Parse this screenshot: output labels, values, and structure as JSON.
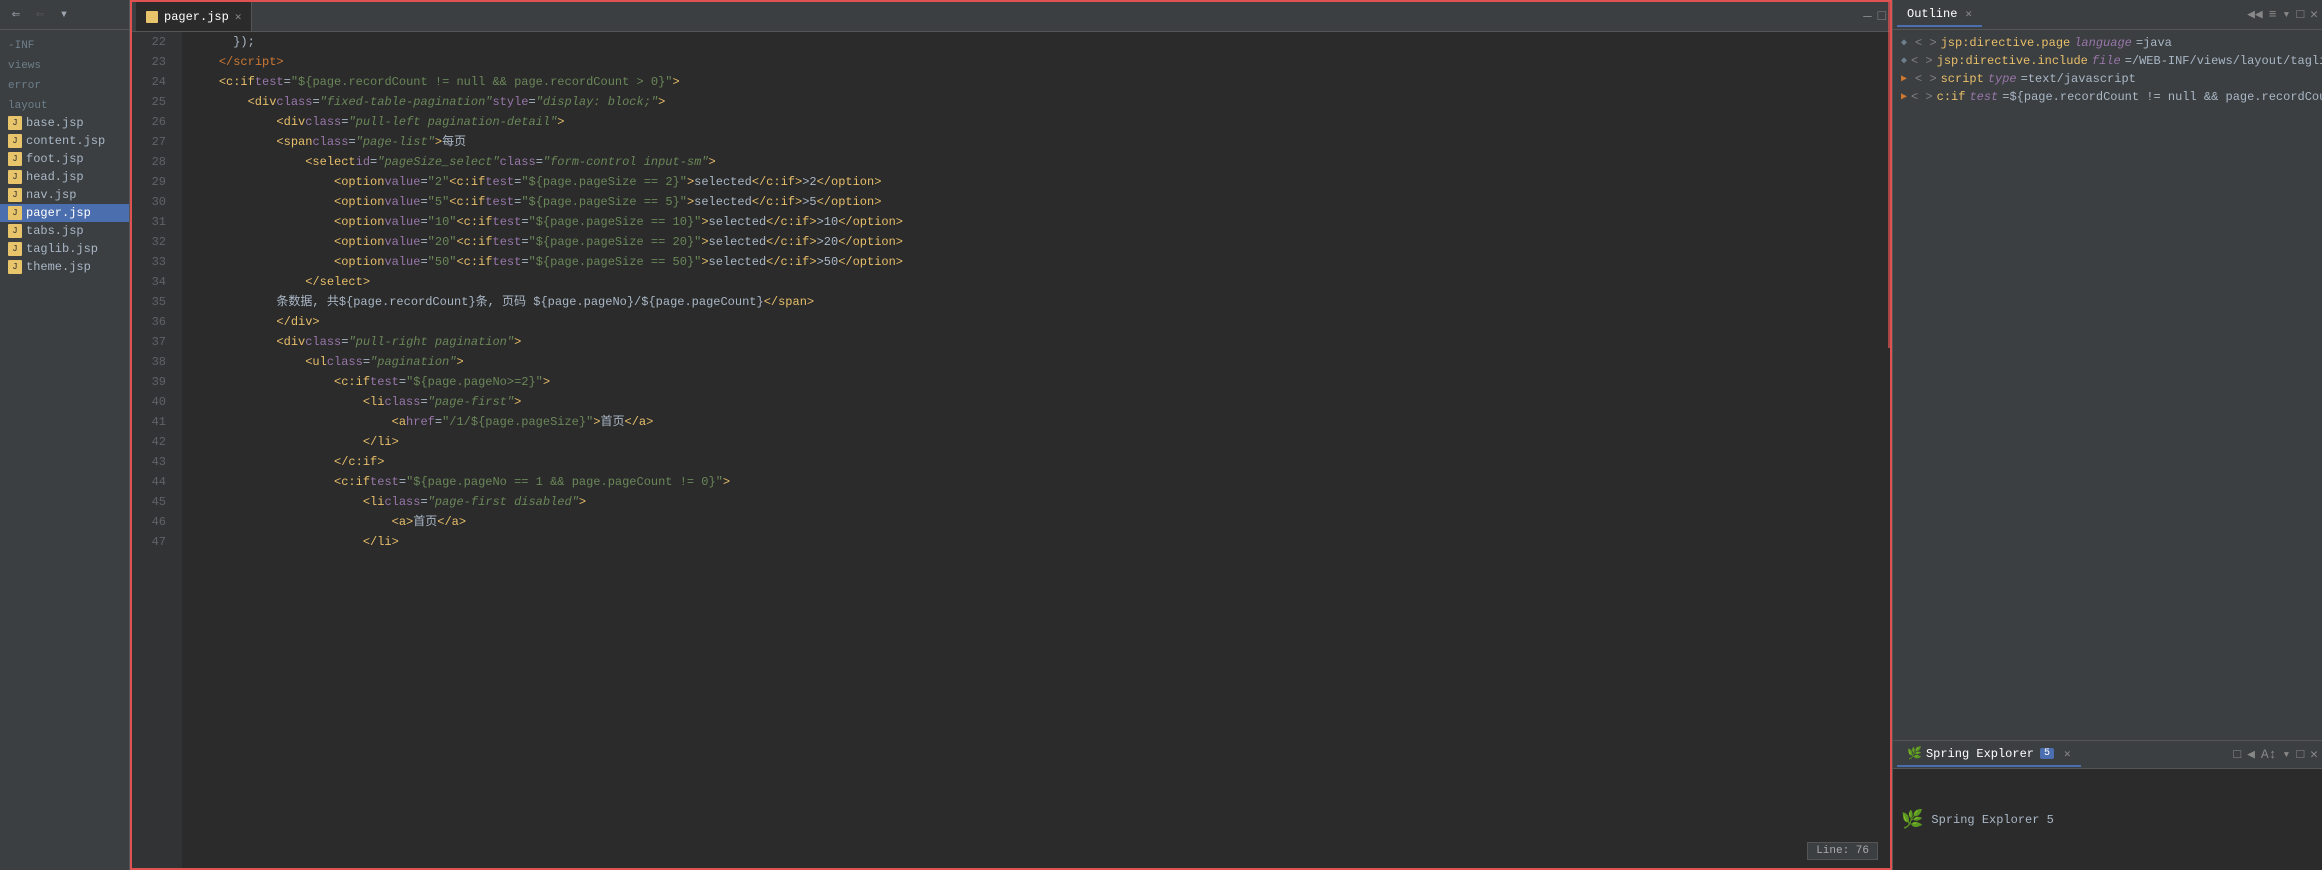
{
  "sidebar": {
    "toolbar": {
      "minimize": "—",
      "restore": "□",
      "dropdown": "▾"
    },
    "sections": [
      {
        "label": "-INF"
      },
      {
        "label": "views"
      },
      {
        "label": "error"
      },
      {
        "label": "layout"
      }
    ],
    "files": [
      {
        "name": "base.jsp",
        "selected": false
      },
      {
        "name": "content.jsp",
        "selected": false
      },
      {
        "name": "foot.jsp",
        "selected": false
      },
      {
        "name": "head.jsp",
        "selected": false
      },
      {
        "name": "nav.jsp",
        "selected": false
      },
      {
        "name": "pager.jsp",
        "selected": true
      },
      {
        "name": "tabs.jsp",
        "selected": false
      },
      {
        "name": "taglib.jsp",
        "selected": false
      },
      {
        "name": "theme.jsp",
        "selected": false
      }
    ]
  },
  "editor": {
    "tab_label": "pager.jsp",
    "tab_close": "✕",
    "win_min": "—",
    "win_max": "□",
    "line_indicator": "Line: 76",
    "lines": [
      {
        "num": "22",
        "content": "      });"
      },
      {
        "num": "23",
        "content": "    <span class='kw'>&lt;/script&gt;</span>"
      },
      {
        "num": "24",
        "content": "    <span class='tag'>&lt;c:if</span> <span class='attr-name'>test</span>=<span class='attr-val'>&quot;${page.recordCount != null &amp;&amp; page.recordCount &gt; 0}&quot;</span><span class='tag'>&gt;</span>"
      },
      {
        "num": "25",
        "content": "        <span class='tag'>&lt;div</span> <span class='attr-name'>class</span>=<span class='class-val'>&quot;fixed-table-pagination&quot;</span> <span class='attr-name'>style</span>=<span class='style-val'>&quot;display: block;&quot;</span><span class='tag'>&gt;</span>"
      },
      {
        "num": "26",
        "content": "            <span class='tag'>&lt;div</span> <span class='attr-name'>class</span>=<span class='class-val'>&quot;pull-left pagination-detail&quot;</span><span class='tag'>&gt;</span>"
      },
      {
        "num": "27",
        "content": "            <span class='tag'>&lt;span</span> <span class='attr-name'>class</span>=<span class='class-val'>&quot;page-list&quot;</span><span class='tag'>&gt;</span><span class='cn-text'>每页</span>"
      },
      {
        "num": "28",
        "content": "                <span class='tag'>&lt;select</span> <span class='attr-name'>id</span>=<span class='class-val'>&quot;pageSize_select&quot;</span> <span class='attr-name'>class</span>=<span class='class-val'>&quot;form-control input-sm&quot;</span><span class='tag'>&gt;</span>"
      },
      {
        "num": "29",
        "content": "                    <span class='tag'>&lt;option</span> <span class='attr-name'>value</span>=<span class='option-val'>&quot;2&quot;</span> <span class='tag'>&lt;c:if</span> <span class='attr-name'>test</span>=<span class='attr-val'>&quot;${page.pageSize == 2}&quot;</span><span class='tag'>&gt;</span>selected<span class='tag'>&lt;/c:if&gt;</span>&gt;2<span class='tag'>&lt;/option&gt;</span>"
      },
      {
        "num": "30",
        "content": "                    <span class='tag'>&lt;option</span> <span class='attr-name'>value</span>=<span class='option-val'>&quot;5&quot;</span> <span class='tag'>&lt;c:if</span> <span class='attr-name'>test</span>=<span class='attr-val'>&quot;${page.pageSize == 5}&quot;</span><span class='tag'>&gt;</span>selected<span class='tag'>&lt;/c:if&gt;</span>&gt;5<span class='tag'>&lt;/option&gt;</span>"
      },
      {
        "num": "31",
        "content": "                    <span class='tag'>&lt;option</span> <span class='attr-name'>value</span>=<span class='option-val'>&quot;10&quot;</span> <span class='tag'>&lt;c:if</span> <span class='attr-name'>test</span>=<span class='attr-val'>&quot;${page.pageSize == 10}&quot;</span><span class='tag'>&gt;</span>selected<span class='tag'>&lt;/c:if&gt;</span>&gt;10<span class='tag'>&lt;/option&gt;</span>"
      },
      {
        "num": "32",
        "content": "                    <span class='tag'>&lt;option</span> <span class='attr-name'>value</span>=<span class='option-val'>&quot;20&quot;</span> <span class='tag'>&lt;c:if</span> <span class='attr-name'>test</span>=<span class='attr-val'>&quot;${page.pageSize == 20}&quot;</span><span class='tag'>&gt;</span>selected<span class='tag'>&lt;/c:if&gt;</span>&gt;20<span class='tag'>&lt;/option&gt;</span>"
      },
      {
        "num": "33",
        "content": "                    <span class='tag'>&lt;option</span> <span class='attr-name'>value</span>=<span class='option-val'>&quot;50&quot;</span> <span class='tag'>&lt;c:if</span> <span class='attr-name'>test</span>=<span class='attr-val'>&quot;${page.pageSize == 50}&quot;</span><span class='tag'>&gt;</span>selected<span class='tag'>&lt;/c:if&gt;</span>&gt;50<span class='tag'>&lt;/option&gt;</span>"
      },
      {
        "num": "34",
        "content": "                <span class='tag'>&lt;/select&gt;</span>"
      },
      {
        "num": "35",
        "content": "            <span class='cn-text'>条数据, 共${page.recordCount}条, 页码 ${page.pageNo}/${page.pageCount}</span><span class='tag'>&lt;/span&gt;</span>"
      },
      {
        "num": "36",
        "content": "            <span class='tag'>&lt;/div&gt;</span>"
      },
      {
        "num": "37",
        "content": "            <span class='tag'>&lt;div</span> <span class='attr-name'>class</span>=<span class='class-val'>&quot;pull-right pagination&quot;</span><span class='tag'>&gt;</span>"
      },
      {
        "num": "38",
        "content": "                <span class='tag'>&lt;ul</span> <span class='attr-name'>class</span>=<span class='class-val'>&quot;pagination&quot;</span><span class='tag'>&gt;</span>"
      },
      {
        "num": "39",
        "content": "                    <span class='tag'>&lt;c:if</span> <span class='attr-name'>test</span>=<span class='attr-val'>&quot;${page.pageNo&gt;=2}&quot;</span><span class='tag'>&gt;</span>"
      },
      {
        "num": "40",
        "content": "                        <span class='tag'>&lt;li</span> <span class='attr-name'>class</span>=<span class='class-val'>&quot;page-first&quot;</span><span class='tag'>&gt;</span>"
      },
      {
        "num": "41",
        "content": "                            <span class='tag'>&lt;a</span> <span class='attr-name'>href</span>=<span class='attr-val'>&quot;/1/${page.pageSize}&quot;</span><span class='tag'>&gt;</span><span class='cn-text'>首页</span><span class='tag'>&lt;/a&gt;</span>"
      },
      {
        "num": "42",
        "content": "                        <span class='tag'>&lt;/li&gt;</span>"
      },
      {
        "num": "43",
        "content": "                    <span class='tag'>&lt;/c:if&gt;</span>"
      },
      {
        "num": "44",
        "content": "                    <span class='tag'>&lt;c:if</span> <span class='attr-name'>test</span>=<span class='attr-val'>&quot;${page.pageNo == 1 &amp;&amp; page.pageCount != 0}&quot;</span><span class='tag'>&gt;</span>"
      },
      {
        "num": "45",
        "content": "                        <span class='tag'>&lt;li</span> <span class='attr-name'>class</span>=<span class='class-val'>&quot;page-first disabled&quot;</span><span class='tag'>&gt;</span>"
      },
      {
        "num": "46",
        "content": "                            <span class='tag'>&lt;a&gt;</span><span class='cn-text'>首页</span><span class='tag'>&lt;/a&gt;</span>"
      },
      {
        "num": "47",
        "content": "                        <span class='tag'>&lt;/li&gt;</span>"
      }
    ]
  },
  "outline": {
    "title": "Outline",
    "close_icon": "✕",
    "toolbar_icons": [
      "◀◀",
      "≡",
      "▾",
      "□",
      "✕"
    ],
    "items": [
      {
        "indent": 0,
        "arrow": "◆",
        "bracket_open": "< >",
        "tag": "jsp:directive.page language=java",
        "has_arrow": false
      },
      {
        "indent": 0,
        "arrow": "◆",
        "bracket_open": "< >",
        "tag": "jsp:directive.include file=/WEB-INF/views/layout/taglib.jsp",
        "has_arrow": false
      },
      {
        "indent": 0,
        "arrow": "▶",
        "bracket_open": "< >",
        "tag": "script type=text/javascript",
        "has_arrow": true
      },
      {
        "indent": 0,
        "arrow": "▶",
        "bracket_open": "< >",
        "tag": "c:if test=${page.recordCount != null && page.recordCount",
        "has_arrow": true
      }
    ]
  },
  "spring_explorer": {
    "title": "Spring Explorer",
    "version": "5",
    "close_icon": "✕",
    "toolbar_icons": [
      "□",
      "◀",
      "A↕",
      "▾",
      "□",
      "✕"
    ]
  }
}
